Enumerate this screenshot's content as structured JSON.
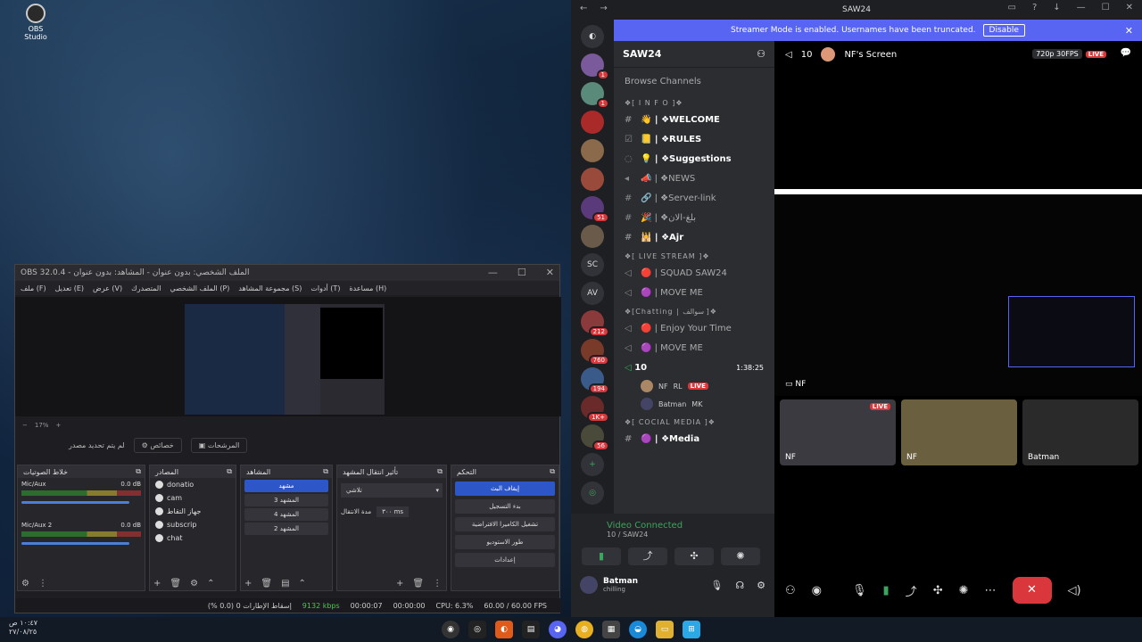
{
  "desktop": {
    "icon_label": "OBS Studio",
    "clock_time": "١٠:٤٧ ص",
    "clock_date": "٢٧/٠٨/٢٥"
  },
  "obs": {
    "title": "OBS 32.0.4 - الملف الشخصي: بدون عنوان - المشاهد: بدون عنوان",
    "menu": [
      "ملف (F)",
      "تعديل (E)",
      "عرض (V)",
      "المتصدرك",
      "الملف الشخصي (P)",
      "مجموعة المشاهد (S)",
      "أدوات (T)",
      "مساعدة (H)"
    ],
    "zoom": "17%",
    "no_source": "لم يتم تحديد مصدر",
    "tab_properties": "خصائص",
    "tab_filters": "المرشحات",
    "docks": {
      "mixer": {
        "title": "خلاط الصوتيات",
        "rows": [
          {
            "name": "Mic/Aux",
            "db": "0.0 dB"
          },
          {
            "name": "Mic/Aux 2",
            "db": "0.0 dB"
          }
        ]
      },
      "sources": {
        "title": "المصادر",
        "items": [
          "donatio",
          "cam",
          "جهاز التقاط",
          "subscrip",
          "chat"
        ]
      },
      "scenes": {
        "title": "المشاهد",
        "items": [
          "مشهد",
          "المشهد 3",
          "المشهد 4",
          "المشهد 2"
        ]
      },
      "transitions": {
        "title": "تأثير انتقال المشهد",
        "select": "تلاشي",
        "duration_label": "مدة الانتقال",
        "duration_value": "٣٠٠ ms"
      },
      "controls": {
        "title": "التحكم",
        "buttons": [
          "إيقاف البث",
          "بدء التسجيل",
          "تشغيل الكاميرا الافتراضية",
          "طور الاستوديو",
          "إعدادات"
        ]
      }
    },
    "status": {
      "dropped": "إسقاط الإطارات 0 (0.0 %)",
      "bitrate": "9132 kbps",
      "live_time": "00:00:07",
      "rec_time": "00:00:00",
      "cpu": "CPU: 6.3%",
      "fps": "60.00 / 60.00 FPS"
    }
  },
  "discord": {
    "window_title": "SAW24",
    "banner": "Streamer Mode is enabled. Usernames have been truncated.",
    "banner_button": "Disable",
    "server_name": "SAW24",
    "browse": "Browse Channels",
    "guild_badges": [
      "1",
      "1",
      "51",
      "212",
      "760",
      "194",
      "1K+",
      "56"
    ],
    "guild_text": [
      "SC",
      "AV"
    ],
    "categories": {
      "info": "❖[ I N F O ]❖",
      "live": "❖[ LIVE STREAM ]❖",
      "chatting": "❖[Chatting | سوالف ]❖",
      "social": "❖[ COCIAL MEDIA ]❖"
    },
    "info_channels": [
      "👋 | ❖WELCOME",
      "📒 | ❖RULES",
      "💡 | ❖Suggestions",
      "📣 | ❖NEWS",
      "🔗 | ❖Server-link",
      "🎉 | ❖بلغ-الان",
      "🕌 | ❖Ajr"
    ],
    "live_channels": [
      "🔴 | SQUAD SAW24",
      "🟣 | MOVE ME"
    ],
    "chat_channels": [
      "🔴 | Enjoy Your Time",
      "🟣 | MOVE ME"
    ],
    "voice_channel": {
      "name": "10",
      "time": "1:38:25"
    },
    "voice_users": [
      {
        "name": "NF",
        "tag": "RL",
        "live": "LIVE"
      },
      {
        "name": "Batman",
        "tag": "MK"
      }
    ],
    "social_channels": [
      "🟣 | ❖Media"
    ],
    "vc": {
      "status": "Video Connected",
      "sub": "10 / SAW24"
    },
    "me": {
      "name": "Batman",
      "status": "chilling"
    },
    "stage": {
      "count": "10",
      "screen_title": "NF's Screen",
      "quality": "720p 30FPS",
      "live": "LIVE",
      "focused_label": "NF",
      "tiles": [
        {
          "name": "NF",
          "live": "LIVE"
        },
        {
          "name": "NF"
        },
        {
          "name": "Batman"
        }
      ]
    }
  }
}
